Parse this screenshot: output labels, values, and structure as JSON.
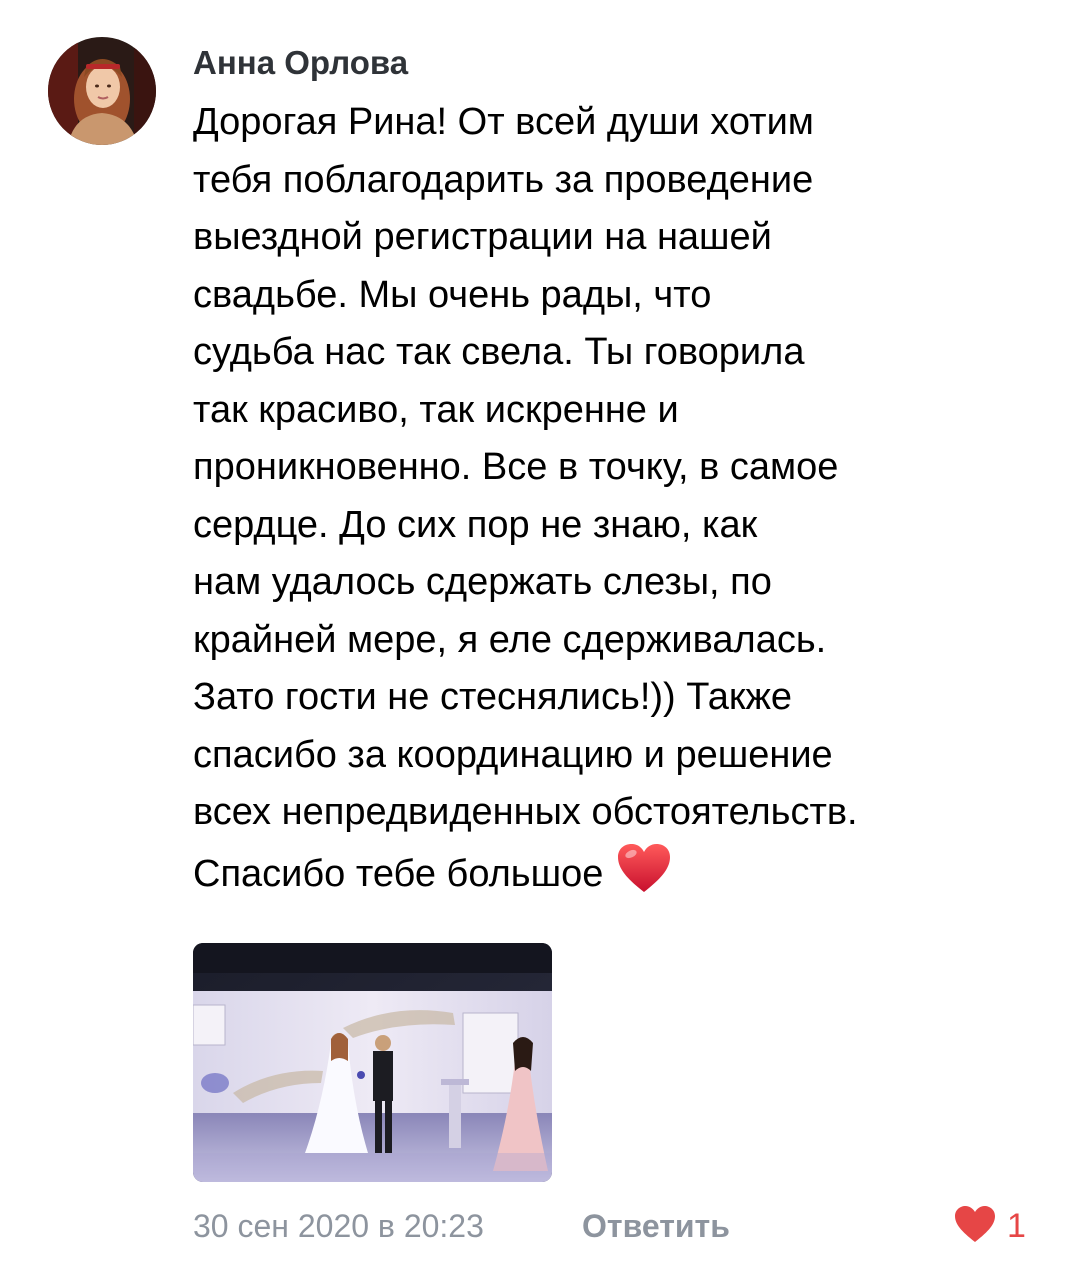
{
  "comment": {
    "author_name": "Анна Орлова",
    "text_lines": [
      "Дорогая Рина! От всей души хотим",
      "тебя поблагодарить за проведение",
      "выездной регистрации на нашей",
      "свадьбе. Мы очень рады, что",
      "судьба нас так свела. Ты говорила",
      "так красиво, так искренне и",
      "проникновенно. Все в точку, в самое",
      "сердце. До сих пор не знаю, как",
      "нам удалось сдержать слезы, по",
      "крайней мере, я еле сдерживалась.",
      "Зато гости не стеснялись!)) Также",
      "спасибо за координацию и решение",
      "всех непредвиденных обстоятельств.",
      "Спасибо тебе большое"
    ],
    "emoji": "red-heart-emoji",
    "photo": "wedding-ceremony-photo",
    "date": "30 сен 2020 в 20:23",
    "reply_label": "Ответить",
    "like_icon": "heart-icon",
    "like_count": "1",
    "colors": {
      "meta_gray": "#8d949e",
      "author": "#2f3338",
      "like_red": "#e64646"
    }
  }
}
